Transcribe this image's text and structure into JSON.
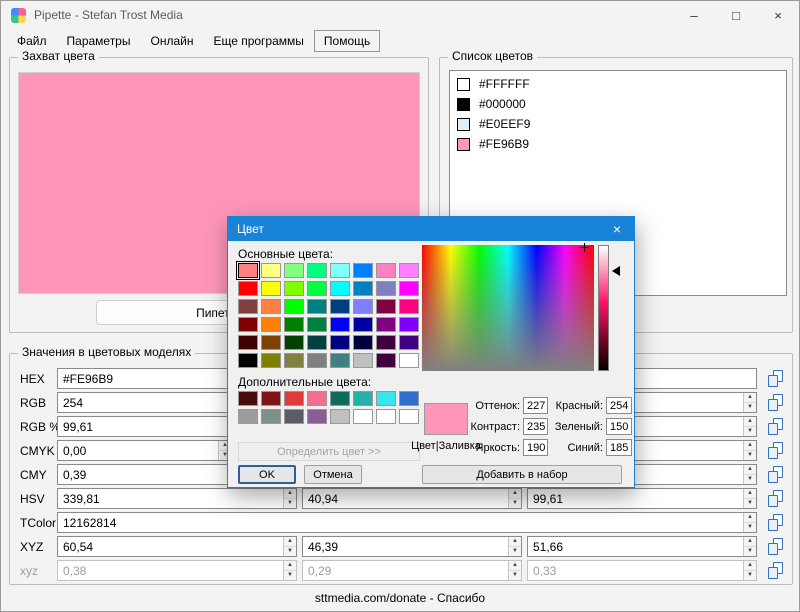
{
  "window": {
    "title": "Pipette - Stefan Trost Media",
    "controls": {
      "minimize": "–",
      "maximize": "□",
      "close": "×"
    }
  },
  "icons": {
    "spinner_up": "▲",
    "spinner_down": "▼"
  },
  "menu": {
    "items": [
      {
        "name": "file",
        "label": "Файл"
      },
      {
        "name": "options",
        "label": "Параметры"
      },
      {
        "name": "online",
        "label": "Онлайн"
      },
      {
        "name": "more-programs",
        "label": "Еще программы"
      },
      {
        "name": "help",
        "label": "Помощь",
        "focused": true
      }
    ]
  },
  "capture": {
    "group_label": "Захват цвета",
    "color": "#FE96B9",
    "button_label": "Пипетка"
  },
  "color_list": {
    "group_label": "Список цветов",
    "items": [
      {
        "hex": "#FFFFFF"
      },
      {
        "hex": "#000000"
      },
      {
        "hex": "#E0EEF9"
      },
      {
        "hex": "#FE96B9"
      }
    ]
  },
  "values": {
    "group_label": "Значения в цветовых моделях",
    "rows": [
      {
        "label": "HEX",
        "fields": [
          "#FE96B9"
        ],
        "spinner": false
      },
      {
        "label": "RGB",
        "fields": [
          "254",
          "",
          ""
        ]
      },
      {
        "label": "RGB %",
        "fields": [
          "99,61",
          "",
          ""
        ]
      },
      {
        "label": "CMYK",
        "fields": [
          "0,00",
          "",
          "",
          ""
        ]
      },
      {
        "label": "CMY",
        "fields": [
          "0,39",
          "",
          ""
        ]
      },
      {
        "label": "HSV",
        "fields": [
          "339,81",
          "40,94",
          "99,61"
        ]
      },
      {
        "label": "TColor",
        "fields": [
          "12162814"
        ]
      },
      {
        "label": "XYZ",
        "fields": [
          "60,54",
          "46,39",
          "51,66"
        ]
      },
      {
        "label": "xyz",
        "fields": [
          "0,38",
          "0,29",
          "0,33"
        ],
        "disabled": true
      }
    ]
  },
  "status": {
    "text": "sttmedia.com/donate - Спасибо"
  },
  "dialog": {
    "title": "Цвет",
    "close_glyph": "×",
    "accent": "#1883d7",
    "basic_label": "Основные цвета:",
    "basic_colors": [
      "#FF8080",
      "#FFFF80",
      "#80FF80",
      "#00FF80",
      "#80FFFF",
      "#0080FF",
      "#FF80C0",
      "#FF80FF",
      "#FF0000",
      "#FFFF00",
      "#80FF00",
      "#00FF40",
      "#00FFFF",
      "#0080C0",
      "#8080C0",
      "#FF00FF",
      "#804040",
      "#FF8040",
      "#00FF00",
      "#008080",
      "#004080",
      "#8080FF",
      "#800040",
      "#FF0080",
      "#800000",
      "#FF8000",
      "#008000",
      "#008040",
      "#0000FF",
      "#0000A0",
      "#800080",
      "#8000FF",
      "#400000",
      "#804000",
      "#004000",
      "#004040",
      "#000080",
      "#000040",
      "#400040",
      "#400080",
      "#000000",
      "#808000",
      "#808040",
      "#808080",
      "#408080",
      "#C0C0C0",
      "#400040",
      "#FFFFFF"
    ],
    "selected_basic_index": 0,
    "custom_label": "Дополнительные цвета:",
    "custom_colors": [
      "#4A0D0D",
      "#7E1416",
      "#E03A3A",
      "#F07090",
      "#0E6B5C",
      "#27B0A8",
      "#39E6EE",
      "#2F6FD0",
      "#9C9C9C",
      "#7F8F8A",
      "#5C5C66",
      "#8B5C96",
      "#C0C0C0",
      "#FFFFFF",
      "#FFFFFF",
      "#FFFFFF"
    ],
    "define_button": "Определить цвет >>",
    "ok": "OK",
    "cancel": "Отмена",
    "add": "Добавить в набор",
    "preview_color": "#FE96B9",
    "preview_label": "Цвет|Заливка",
    "hsl": [
      {
        "name": "hue",
        "label": "Оттенок:",
        "value": "227"
      },
      {
        "name": "contrast",
        "label": "Контраст:",
        "value": "235"
      },
      {
        "name": "brightness",
        "label": "Яркость:",
        "value": "190"
      }
    ],
    "rgb": [
      {
        "name": "red",
        "label": "Красный:",
        "value": "254"
      },
      {
        "name": "green",
        "label": "Зеленый:",
        "value": "150"
      },
      {
        "name": "blue",
        "label": "Синий:",
        "value": "185"
      }
    ]
  }
}
